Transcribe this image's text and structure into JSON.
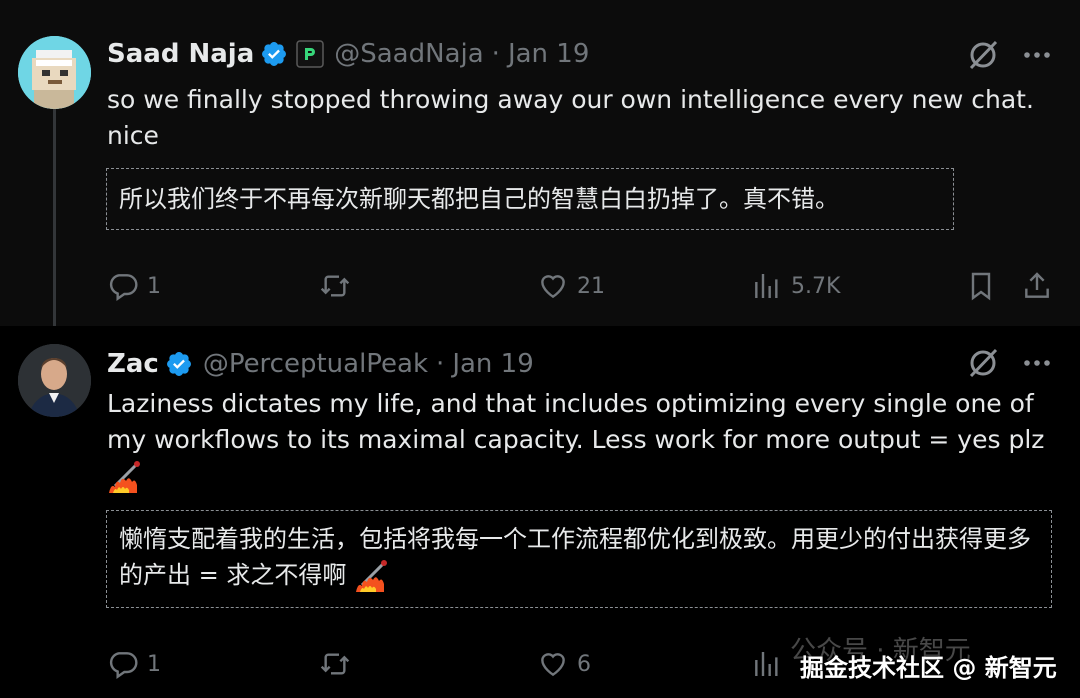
{
  "tweets": [
    {
      "author": {
        "name": "Saad Naja",
        "handle": "@SaadNaja",
        "date": "Jan 19"
      },
      "text": "so we finally stopped throwing away our own intelligence every new chat. nice",
      "translation": "所以我们终于不再每次新聊天都把自己的智慧白白扔掉了。真不错。",
      "stats": {
        "replies": "1",
        "retweets": "",
        "likes": "21",
        "views": "5.7K"
      }
    },
    {
      "author": {
        "name": "Zac",
        "handle": "@PerceptualPeak",
        "date": "Jan 19"
      },
      "text": "Laziness dictates my life, and that includes optimizing every single one of my workflows to its maximal capacity. Less work for more output = yes plz",
      "translation": "懒惰支配着我的生活，包括将我每一个工作流程都优化到极致。用更少的付出获得更多的产出 = 求之不得啊",
      "stats": {
        "replies": "1",
        "retweets": "",
        "likes": "6"
      }
    }
  ],
  "separator": "·",
  "watermark": {
    "faint": "公众号 · 新智元",
    "text": "掘金技术社区 @ 新智元"
  },
  "colors": {
    "verified": "#1d9bf0",
    "muted": "#71767b",
    "text": "#e7e9ea",
    "background": "#000000"
  },
  "icons": [
    "verified-badge-icon",
    "affiliate-badge-icon",
    "grok-icon",
    "more-icon",
    "reply-icon",
    "retweet-icon",
    "like-icon",
    "views-icon",
    "bookmark-icon",
    "share-icon",
    "muscle-fire-emoji"
  ]
}
